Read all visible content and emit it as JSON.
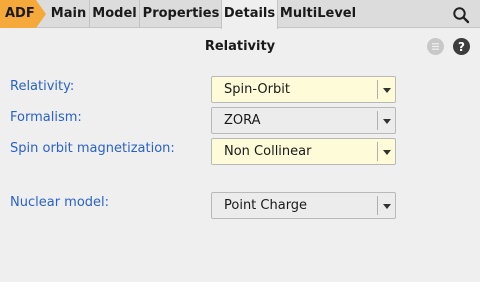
{
  "tabs": {
    "adf": "ADF",
    "items": [
      "Main",
      "Model",
      "Properties",
      "Details",
      "MultiLevel"
    ],
    "active": "Details"
  },
  "colors": {
    "adf_tab": "#f5a93b",
    "label": "#2a62c9",
    "highlight_field": "#fdfbd8"
  },
  "icons": {
    "search": "search-icon",
    "menu": "menu-icon",
    "help": "help-icon"
  },
  "page": {
    "title": "Relativity"
  },
  "form": {
    "relativity": {
      "label": "Relativity:",
      "value": "Spin-Orbit"
    },
    "formalism": {
      "label": "Formalism:",
      "value": "ZORA"
    },
    "spin_orbit_magnetization": {
      "label": "Spin orbit magnetization:",
      "value": "Non Collinear"
    },
    "nuclear_model": {
      "label": "Nuclear model:",
      "value": "Point Charge"
    }
  }
}
